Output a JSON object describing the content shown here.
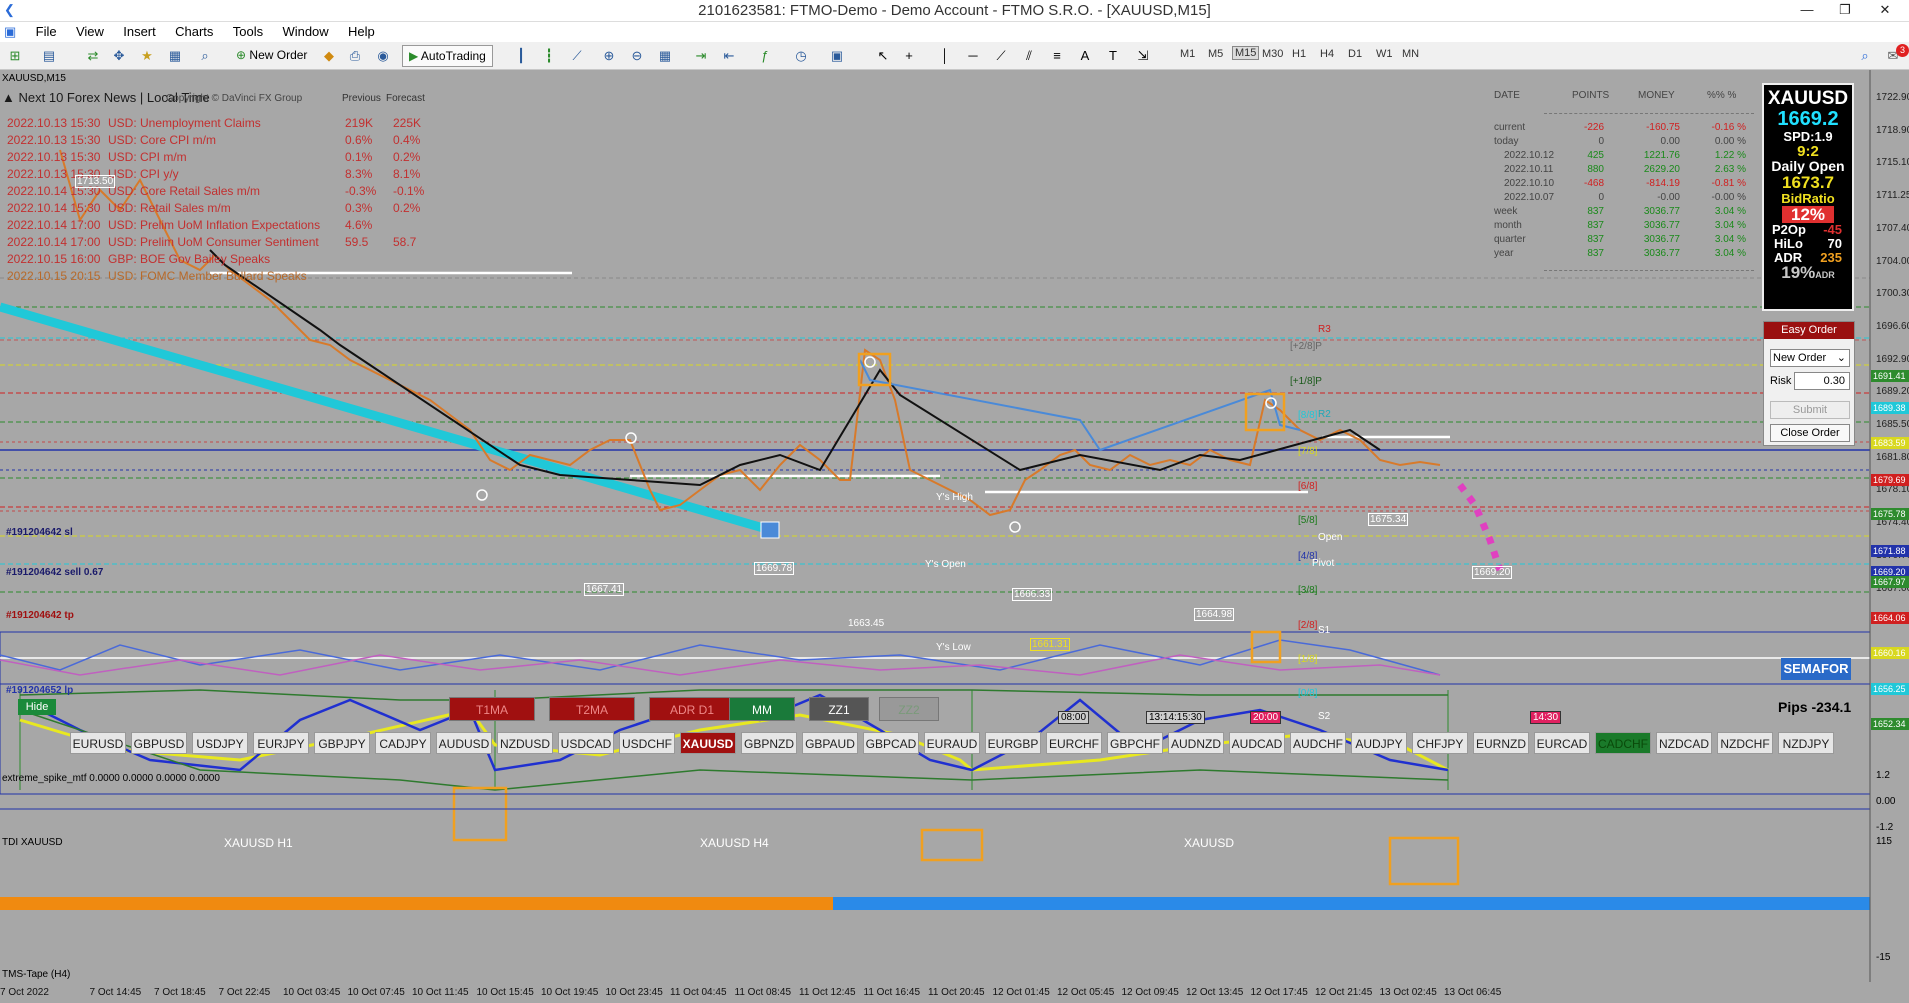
{
  "window": {
    "title": "2101623581: FTMO-Demo - Demo Account - FTMO S.R.O. - [XAUUSD,M15]",
    "min": "—",
    "max": "❐",
    "close": "✕"
  },
  "menu": [
    "File",
    "View",
    "Insert",
    "Charts",
    "Tools",
    "Window",
    "Help"
  ],
  "toolbar": {
    "new_order": "New Order",
    "autotrading": "AutoTrading",
    "timeframes": [
      "M1",
      "M5",
      "M15",
      "M30",
      "H1",
      "H4",
      "D1",
      "W1",
      "MN"
    ],
    "notif_count": "3"
  },
  "chart": {
    "symbol_label": "XAUUSD,M15"
  },
  "news": {
    "title": "Next 10 Forex News | Local Time",
    "overlay": "Copyright © DaVinci FX Group",
    "col_prev": "Previous",
    "col_fcst": "Forecast",
    "rows": [
      {
        "dt": "2022.10.13 15:30",
        "ev": "USD: Unemployment Claims",
        "prev": "219K",
        "fc": "225K",
        "color": "#c23030"
      },
      {
        "dt": "2022.10.13 15:30",
        "ev": "USD: Core CPI m/m",
        "prev": "0.6%",
        "fc": "0.4%",
        "color": "#c23030"
      },
      {
        "dt": "2022.10.13 15:30",
        "ev": "USD: CPI m/m",
        "prev": "0.1%",
        "fc": "0.2%",
        "color": "#c23030"
      },
      {
        "dt": "2022.10.13 15:30",
        "ev": "USD: CPI y/y",
        "prev": "8.3%",
        "fc": "8.1%",
        "color": "#c23030"
      },
      {
        "dt": "2022.10.14 15:30",
        "ev": "USD: Core Retail Sales m/m",
        "prev": "-0.3%",
        "fc": "-0.1%",
        "color": "#c23030"
      },
      {
        "dt": "2022.10.14 15:30",
        "ev": "USD: Retail Sales m/m",
        "prev": "0.3%",
        "fc": "0.2%",
        "color": "#c23030"
      },
      {
        "dt": "2022.10.14 17:00",
        "ev": "USD: Prelim UoM Inflation Expectations",
        "prev": "4.6%",
        "fc": "",
        "color": "#c23030"
      },
      {
        "dt": "2022.10.14 17:00",
        "ev": "USD: Prelim UoM Consumer Sentiment",
        "prev": "59.5",
        "fc": "58.7",
        "color": "#c23030"
      },
      {
        "dt": "2022.10.15 16:00",
        "ev": "GBP: BOE Gov Bailey Speaks",
        "prev": "",
        "fc": "",
        "color": "#c23030"
      },
      {
        "dt": "2022.10.15 20:15",
        "ev": "USD: FOMC Member Bullard Speaks",
        "prev": "",
        "fc": "",
        "color": "#b86a2a"
      }
    ]
  },
  "stats": {
    "headers": [
      "DATE",
      "POINTS",
      "MONEY",
      "%% %"
    ],
    "rows": [
      {
        "d": "current",
        "p": "-226",
        "m": "-160.75",
        "pc": "-0.16 %"
      },
      {
        "d": "today",
        "p": "0",
        "m": "0.00",
        "pc": "0.00 %"
      },
      {
        "d": "2022.10.12",
        "p": "425",
        "m": "1221.76",
        "pc": "1.22 %"
      },
      {
        "d": "2022.10.11",
        "p": "880",
        "m": "2629.20",
        "pc": "2.63 %"
      },
      {
        "d": "2022.10.10",
        "p": "-468",
        "m": "-814.19",
        "pc": "-0.81 %"
      },
      {
        "d": "2022.10.07",
        "p": "0",
        "m": "-0.00",
        "pc": "-0.00 %"
      },
      {
        "d": "week",
        "p": "837",
        "m": "3036.77",
        "pc": "3.04 %"
      },
      {
        "d": "month",
        "p": "837",
        "m": "3036.77",
        "pc": "3.04 %"
      },
      {
        "d": "quarter",
        "p": "837",
        "m": "3036.77",
        "pc": "3.04 %"
      },
      {
        "d": "year",
        "p": "837",
        "m": "3036.77",
        "pc": "3.04 %"
      }
    ]
  },
  "info": {
    "symbol": "XAUUSD",
    "price": "1669.2",
    "spread": "SPD:1.9",
    "timer": "9:2",
    "daily_open_label": "Daily Open",
    "daily_open": "1673.7",
    "bidratio_label": "BidRatio",
    "bidratio": "12%",
    "p2op_label": "P2Op",
    "p2op": "-45",
    "hilo_label": "HiLo",
    "hilo": "70",
    "adr_label": "ADR",
    "adr": "235",
    "adr_pct": "19%",
    "adr_suffix": "ADR"
  },
  "easy_order": {
    "title": "Easy Order",
    "select": "New Order",
    "risk_label": "Risk",
    "risk": "0.30",
    "submit": "Submit",
    "close": "Close Order"
  },
  "price_axis": [
    "1722.90",
    "1718.90",
    "1715.10",
    "1711.25",
    "1707.40",
    "1704.00",
    "1700.30",
    "1696.60",
    "1692.90",
    "1689.20",
    "1685.50",
    "1681.80",
    "1678.10",
    "1674.40",
    "1670.70",
    "1667.00",
    "1663.30",
    "1659.60"
  ],
  "price_boxes": [
    {
      "v": "1691.41",
      "bg": "#2e8b2e",
      "fg": "#fff"
    },
    {
      "v": "1689.38",
      "bg": "#20c8d8",
      "fg": "#fff"
    },
    {
      "v": "1683.59",
      "bg": "#d8d820",
      "fg": "#fff"
    },
    {
      "v": "1679.69",
      "bg": "#d02020",
      "fg": "#fff"
    },
    {
      "v": "1675.78",
      "bg": "#2e8b2e",
      "fg": "#fff"
    },
    {
      "v": "1671.88",
      "bg": "#2233aa",
      "fg": "#fff"
    },
    {
      "v": "1669.20",
      "bg": "#2233aa",
      "fg": "#fff"
    },
    {
      "v": "1667.97",
      "bg": "#2e8b2e",
      "fg": "#fff"
    },
    {
      "v": "1664.06",
      "bg": "#d02020",
      "fg": "#fff"
    },
    {
      "v": "1660.16",
      "bg": "#d8d820",
      "fg": "#fff"
    },
    {
      "v": "1656.25",
      "bg": "#20c8d8",
      "fg": "#fff"
    },
    {
      "v": "1652.34",
      "bg": "#2e8b2e",
      "fg": "#fff"
    }
  ],
  "levels": {
    "r3": "R3",
    "p28p": "[+2/8]P",
    "p18p": "[+1/8]P",
    "r2": "R2",
    "l88": "[8/8]",
    "l78": "[7/8]",
    "l68": "[6/8]",
    "l58": "[5/8]",
    "l48": "[4/8]",
    "l38": "[3/8]",
    "l28": "[2/8]",
    "l18": "[1/8]",
    "l08": "[0/8]",
    "s1": "S1",
    "s2": "S2",
    "open": "Open",
    "pivot": "Pivot",
    "ys_high": "Y's High",
    "ys_open": "Y's Open",
    "ys_low": "Y's Low"
  },
  "chart_labels": [
    "1713.50",
    "1667.41",
    "1669.78",
    "1663.45",
    "1666.33",
    "1661.31",
    "1664.98",
    "1675.34",
    "1669.20"
  ],
  "orders": {
    "sl": "#191204642 sl",
    "sell": "#191204642 sell 0.67",
    "tp": "#191204642 tp",
    "lp": "#191204652 lp"
  },
  "buttons": {
    "hide": "Hide",
    "t1ma": "T1MA",
    "t2ma": "T2MA",
    "adr": "ADR D1",
    "mm": "MM",
    "zz1": "ZZ1",
    "zz2": "ZZ2",
    "semafor": "SEMAFOR",
    "pips": "Pips -234.1"
  },
  "time_markers": [
    "08:00",
    "13:14:15:30",
    "20:00",
    "14:30"
  ],
  "symbols": [
    "EURUSD",
    "GBPUSD",
    "USDJPY",
    "EURJPY",
    "GBPJPY",
    "CADJPY",
    "AUDUSD",
    "NZDUSD",
    "USDCAD",
    "USDCHF",
    "XAUUSD",
    "GBPNZD",
    "GBPAUD",
    "GBPCAD",
    "EURAUD",
    "EURGBP",
    "EURCHF",
    "GBPCHF",
    "AUDNZD",
    "AUDCAD",
    "AUDCHF",
    "AUDJPY",
    "CHFJPY",
    "EURNZD",
    "EURCAD",
    "CADCHF",
    "NZDCAD",
    "NZDCHF",
    "NZDJPY"
  ],
  "indicator1": {
    "label": "extreme_spike_mtf 0.0000 0.0000 0.0000 0.0000",
    "axis": [
      "1.2",
      "0.00",
      "-1.2"
    ]
  },
  "indicator2": {
    "label": "TDI XAUUSD",
    "tf1": "XAUUSD H1",
    "tf2": "XAUUSD H4",
    "tf3": "XAUUSD",
    "axis": [
      "115",
      "-15"
    ]
  },
  "tape": {
    "label": "TMS-Tape (H4)"
  },
  "time_axis": [
    "7 Oct 2022",
    "7 Oct 14:45",
    "7 Oct 18:45",
    "7 Oct 22:45",
    "10 Oct 03:45",
    "10 Oct 07:45",
    "10 Oct 11:45",
    "10 Oct 15:45",
    "10 Oct 19:45",
    "10 Oct 23:45",
    "11 Oct 04:45",
    "11 Oct 08:45",
    "11 Oct 12:45",
    "11 Oct 16:45",
    "11 Oct 20:45",
    "12 Oct 01:45",
    "12 Oct 05:45",
    "12 Oct 09:45",
    "12 Oct 13:45",
    "12 Oct 17:45",
    "12 Oct 21:45",
    "13 Oct 02:45",
    "13 Oct 06:45"
  ]
}
